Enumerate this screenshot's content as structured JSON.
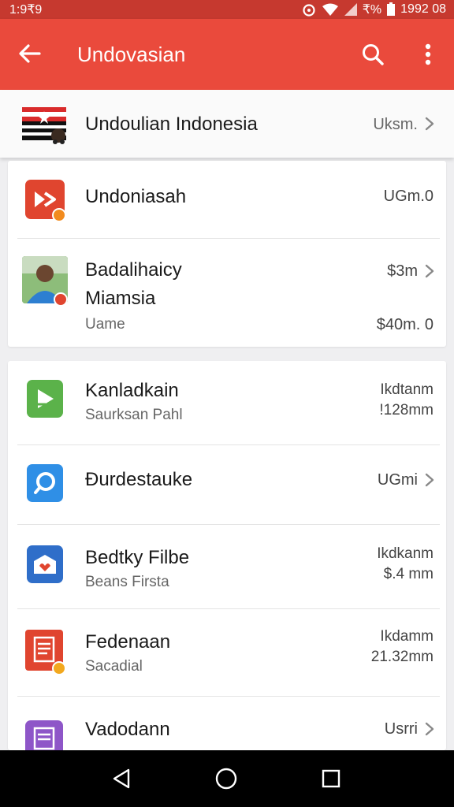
{
  "status": {
    "time": "1:9₹9",
    "battery_text": "₹%",
    "clock": "1992 08"
  },
  "appbar": {
    "title": "Undovasian"
  },
  "header": {
    "title": "Undoulian Indonesia",
    "meta": "Uksm."
  },
  "items": [
    {
      "title": "Undoniasah",
      "meta": "UGm.0"
    },
    {
      "title_line1": "Badalihaicy",
      "title_line2": "Miamsia",
      "subtitle": "Uame",
      "meta1": "$3m",
      "meta2": "$40m. 0"
    },
    {
      "title": "Kanladkain",
      "subtitle": "Saurksan Pahl",
      "meta1": "Ikdtanm",
      "meta2": "!128mm"
    },
    {
      "title": "Ɖurdestauke",
      "meta": "UGmi"
    },
    {
      "title": "Bedtky Filbe",
      "subtitle": "Beans Firsta",
      "meta1": "Ikdkanm",
      "meta2": "$.4 mm"
    },
    {
      "title": "Fedenaan",
      "subtitle": "Sacadial",
      "meta1": "Ikdamm",
      "meta2": "21.32mm"
    },
    {
      "title": "Vadodann",
      "meta": "Usrri"
    }
  ],
  "colors": {
    "accent": "#ea4a3c",
    "status_bar": "#c6392f",
    "green": "#5bb24a",
    "blue": "#2f8fe6",
    "navy": "#2f6ec9",
    "red": "#e0452f",
    "purple": "#8e56c8"
  },
  "icons": [
    "back-arrow-icon",
    "search-icon",
    "more-vert-icon",
    "flag-icon",
    "video-play-icon",
    "avatar",
    "edit-icon",
    "search-circle-icon",
    "mail-icon",
    "document-icon",
    "notes-icon",
    "chevron-right-icon",
    "nav-back-icon",
    "nav-home-icon",
    "nav-recents-icon"
  ]
}
